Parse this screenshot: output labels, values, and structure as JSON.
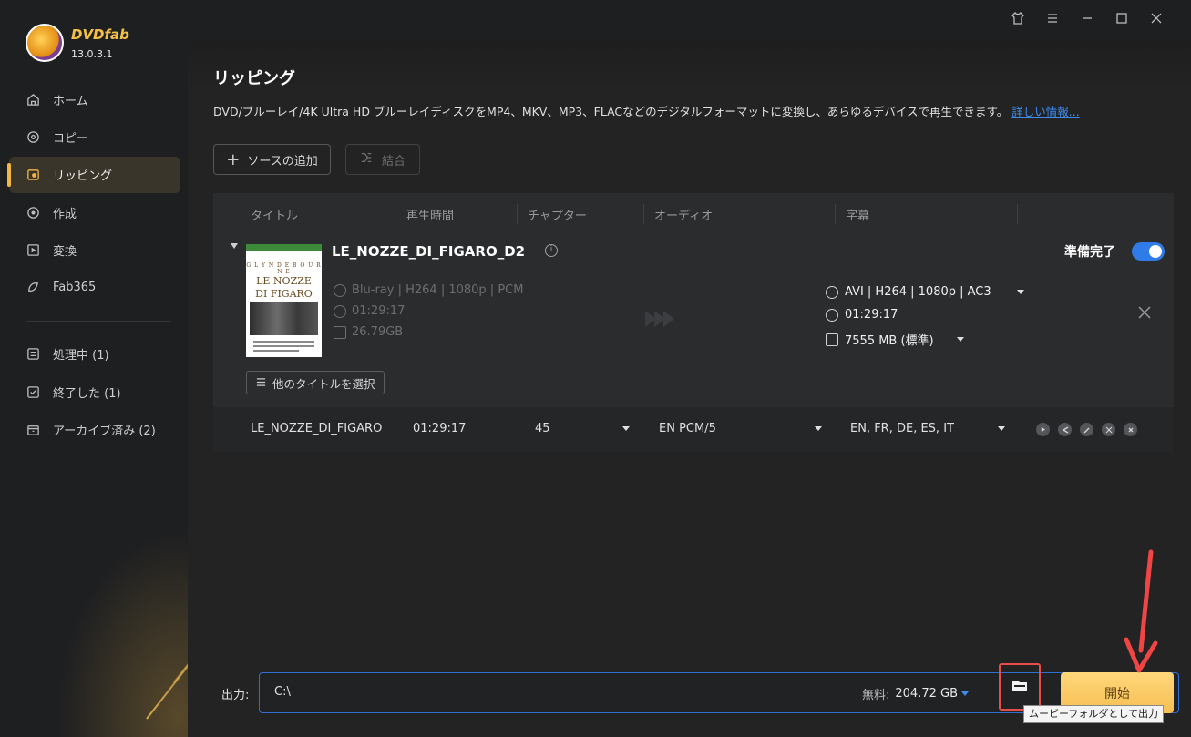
{
  "app": {
    "brand": "DVDfab",
    "version": "13.0.3.1"
  },
  "sidebar": {
    "items": [
      {
        "label": "ホーム",
        "icon": "home-icon",
        "active": false
      },
      {
        "label": "コピー",
        "icon": "copy-icon",
        "active": false
      },
      {
        "label": "リッピング",
        "icon": "ripper-icon",
        "active": true
      },
      {
        "label": "作成",
        "icon": "create-icon",
        "active": false
      },
      {
        "label": "変換",
        "icon": "convert-icon",
        "active": false
      },
      {
        "label": "Fab365",
        "icon": "fab365-icon",
        "active": false
      }
    ],
    "queue": [
      {
        "label": "処理中 (1)",
        "icon": "processing-icon"
      },
      {
        "label": "終了した (1)",
        "icon": "finished-icon"
      },
      {
        "label": "アーカイブ済み (2)",
        "icon": "archive-icon"
      }
    ]
  },
  "window_controls": [
    "tshirt-icon",
    "menu-icon",
    "minimize-icon",
    "maximize-icon",
    "close-icon"
  ],
  "page": {
    "title": "リッピング",
    "description": "DVD/ブルーレイ/4K Ultra HD ブルーレイディスクをMP4、MKV、MP3、FLACなどのデジタルフォーマットに変換し、あらゆるデバイスで再生できます。",
    "more_link": "詳しい情報...",
    "add_source": "ソースの追加",
    "merge": "結合"
  },
  "table": {
    "headers": [
      "タイトル",
      "再生時間",
      "チャプター",
      "オーディオ",
      "字幕"
    ],
    "item": {
      "disc_title": "LE_NOZZE_DI_FIGARO_D2",
      "cover_text_1": "LE NOZZE",
      "cover_text_2": "DI FIGARO",
      "source_format": "Blu-ray | H264 | 1080p | PCM",
      "source_duration": "01:29:17",
      "source_size": "26.79GB",
      "output_format": "AVI | H264 | 1080p | AC3",
      "output_duration": "01:29:17",
      "output_size": "7555 MB (標準)",
      "ready_label": "準備完了",
      "ready_on": true,
      "select_title_button": "他のタイトルを選択"
    },
    "detail": {
      "title": "LE_NOZZE_DI_FIGARO",
      "duration": "01:29:17",
      "chapters": "45",
      "audio": "EN  PCM/5",
      "subtitles": "EN, FR, DE, ES, IT",
      "actions": [
        "play-icon",
        "back-icon",
        "edit-icon",
        "tools-icon",
        "remove-icon"
      ]
    }
  },
  "output": {
    "label": "出力:",
    "path": "C:\\",
    "free_label": "無料:",
    "free_value": "204.72 GB",
    "folder_tooltip": "ムービーフォルダとして出力",
    "start_button": "開始"
  },
  "colors": {
    "accent": "#f3b546",
    "toggle": "#2f7ce8",
    "link": "#3d8cf0",
    "highlight_red": "#e84d4a"
  }
}
